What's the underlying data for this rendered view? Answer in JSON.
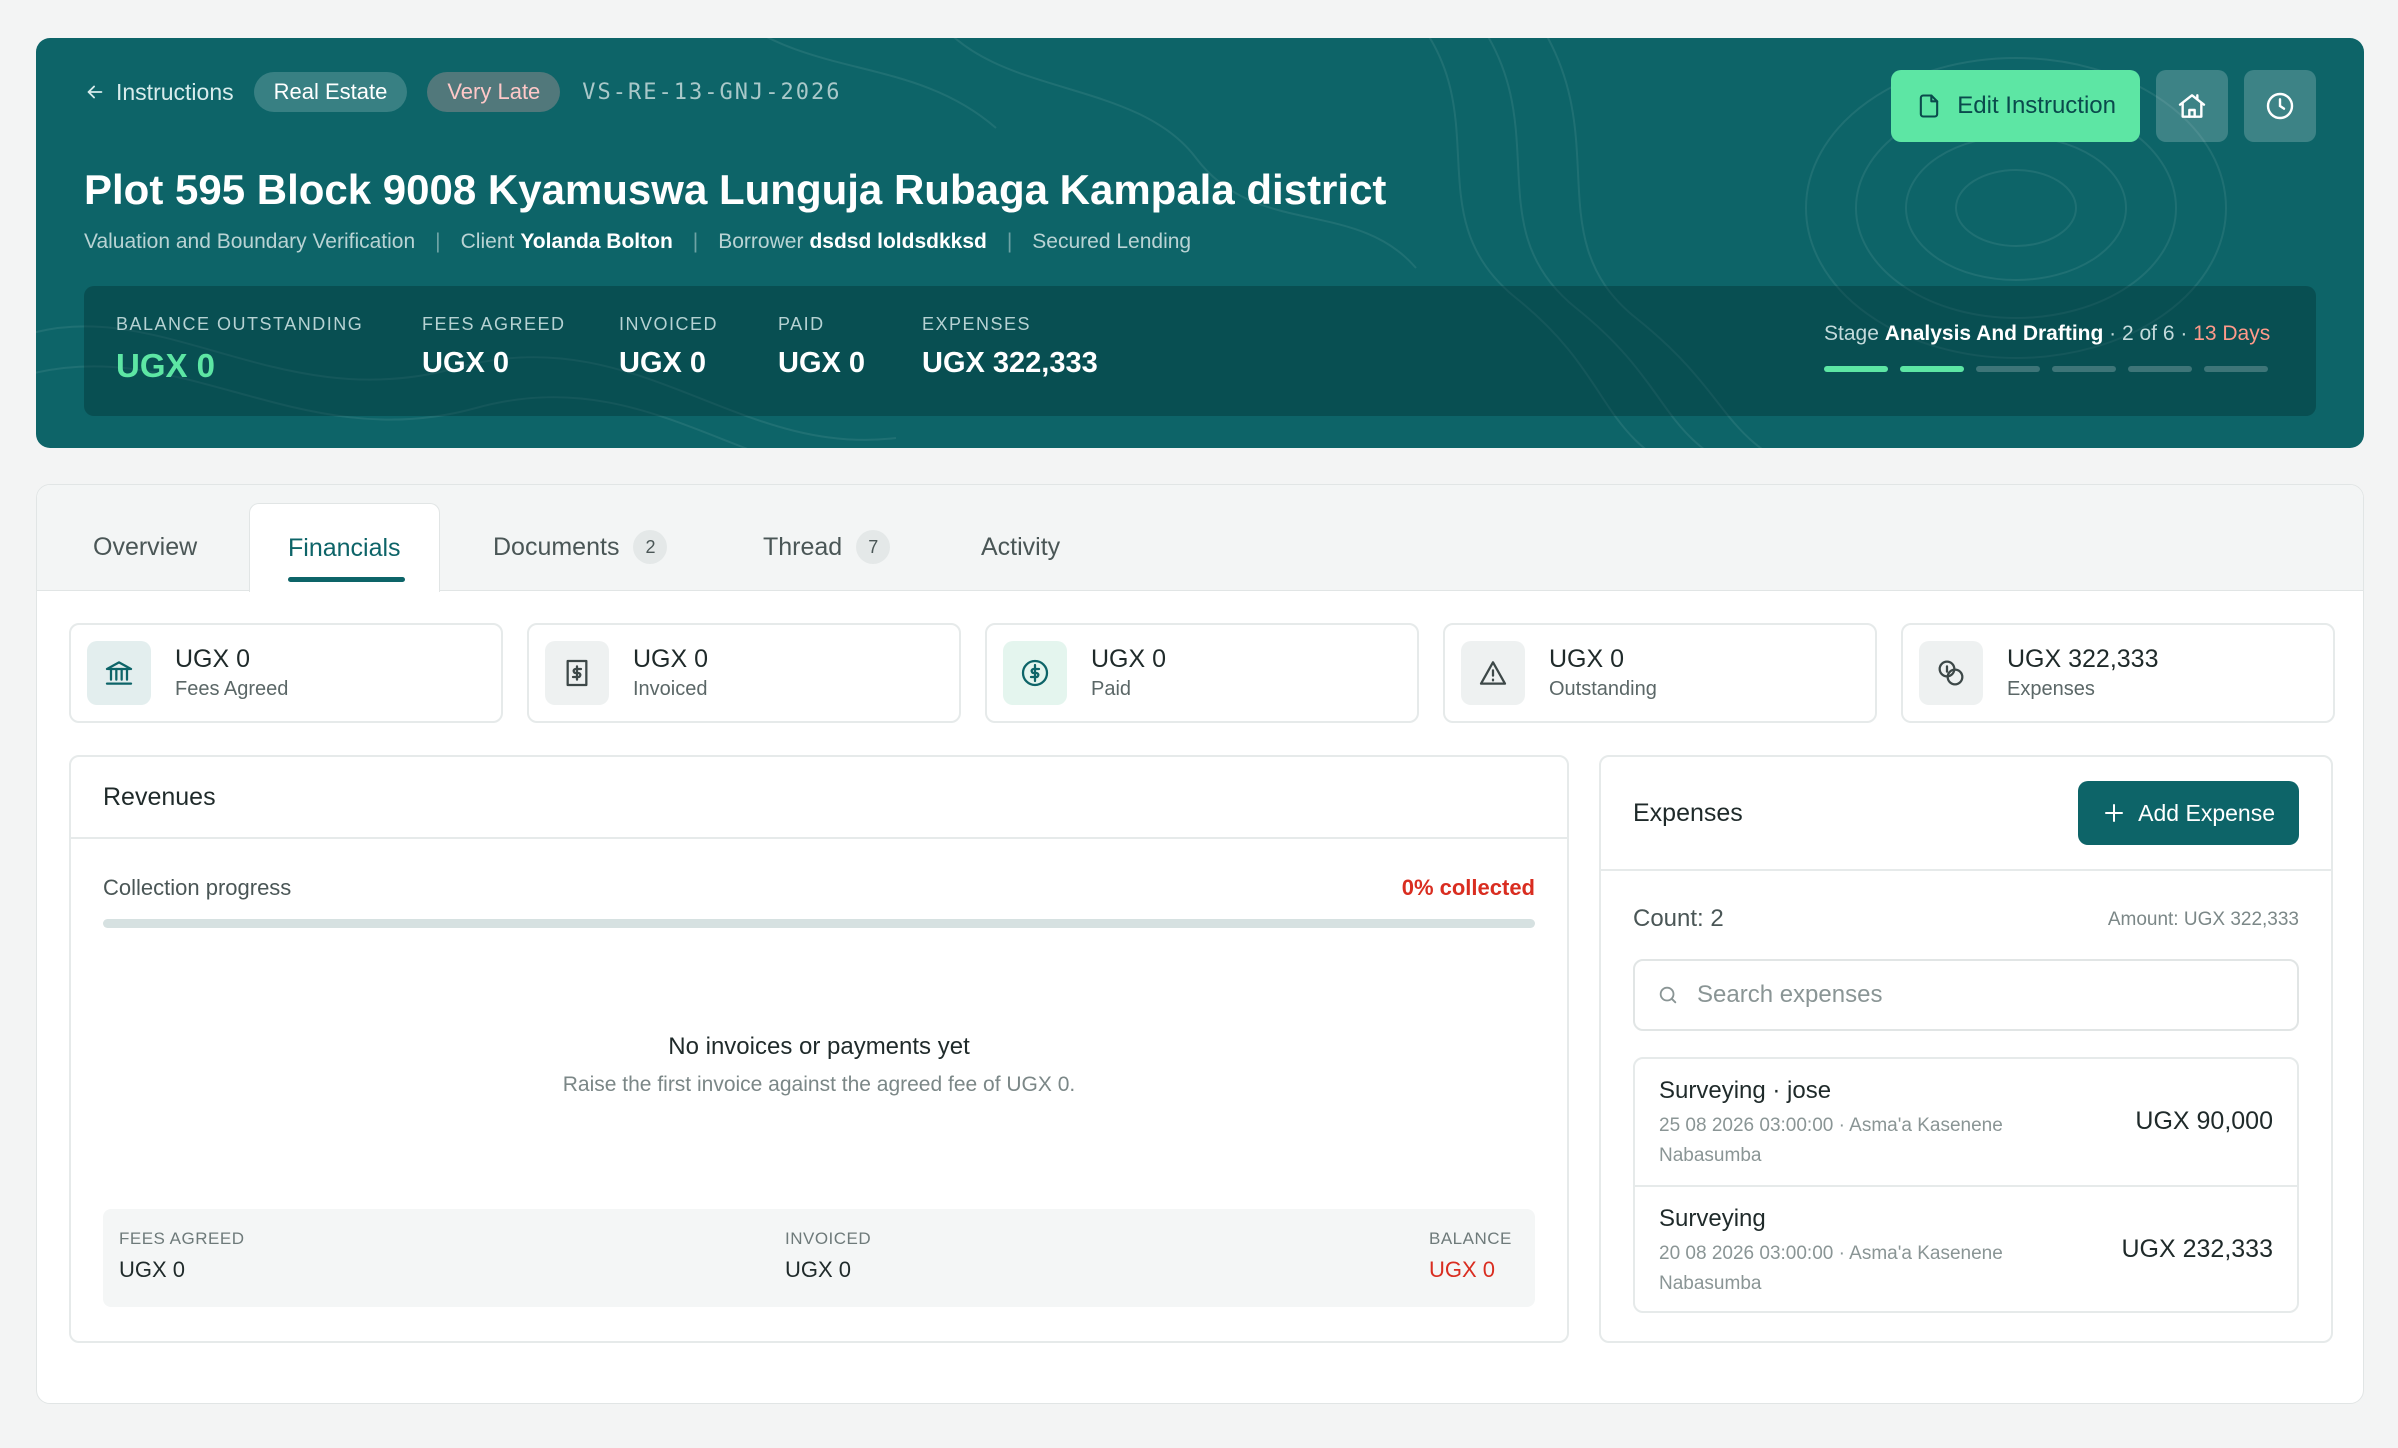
{
  "header": {
    "back_label": "Instructions",
    "category": "Real Estate",
    "status": "Very Late",
    "reference": "VS-RE-13-GNJ-2026",
    "edit_label": "Edit Instruction",
    "title": "Plot 595 Block 9008 Kyamuswa Lunguja Rubaga Kampala district",
    "service": "Valuation and Boundary Verification",
    "client_label": "Client",
    "client_name": "Yolanda Bolton",
    "borrower_label": "Borrower",
    "borrower_name": "dsdsd loldsdkksd",
    "purpose": "Secured Lending",
    "separator": "|",
    "colors": {
      "brand": "#0d6468",
      "accent": "#5de6a4",
      "late": "#ff9a8a"
    }
  },
  "stats": {
    "balance_label": "BALANCE OUTSTANDING",
    "balance_value": "UGX 0",
    "fees_label": "FEES AGREED",
    "fees_value": "UGX 0",
    "invoiced_label": "INVOICED",
    "invoiced_value": "UGX 0",
    "paid_label": "PAID",
    "paid_value": "UGX 0",
    "expenses_label": "EXPENSES",
    "expenses_value": "UGX 322,333"
  },
  "stage": {
    "prefix": "Stage",
    "name": "Analysis And Drafting",
    "position": " · 2 of 6 · ",
    "days": "13 Days",
    "current": 2,
    "total": 6
  },
  "tabs": [
    {
      "label": "Overview"
    },
    {
      "label": "Financials",
      "active": true
    },
    {
      "label": "Documents",
      "count": "2"
    },
    {
      "label": "Thread",
      "count": "7"
    },
    {
      "label": "Activity"
    }
  ],
  "kpis": [
    {
      "value": "UGX 0",
      "label": "Fees Agreed",
      "icon": "bank-icon"
    },
    {
      "value": "UGX 0",
      "label": "Invoiced",
      "icon": "receipt-icon"
    },
    {
      "value": "UGX 0",
      "label": "Paid",
      "icon": "dollar-circle-icon"
    },
    {
      "value": "UGX 0",
      "label": "Outstanding",
      "icon": "warning-icon"
    },
    {
      "value": "UGX 322,333",
      "label": "Expenses",
      "icon": "coins-icon"
    }
  ],
  "revenues": {
    "title": "Revenues",
    "progress_label": "Collection progress",
    "progress_text": "0% collected",
    "progress_fraction": 0,
    "empty_title": "No invoices or payments yet",
    "empty_sub": "Raise the first invoice against the agreed fee of UGX 0.",
    "footer": {
      "fees_label": "FEES AGREED",
      "fees_value": "UGX 0",
      "invoiced_label": "INVOICED",
      "invoiced_value": "UGX 0",
      "balance_label": "BALANCE",
      "balance_value": "UGX 0"
    }
  },
  "expenses": {
    "title": "Expenses",
    "add_label": "Add Expense",
    "count_text": "Count: 2",
    "amount_text": "Amount: UGX 322,333",
    "search_placeholder": "Search expenses",
    "items": [
      {
        "name": "Surveying · jose",
        "meta": "25 08 2026 03:00:00 · Asma'a Kasenene Nabasumba",
        "amount": "UGX 90,000"
      },
      {
        "name": "Surveying",
        "meta": "20 08 2026 03:00:00 · Asma'a Kasenene Nabasumba",
        "amount": "UGX 232,333"
      }
    ]
  }
}
